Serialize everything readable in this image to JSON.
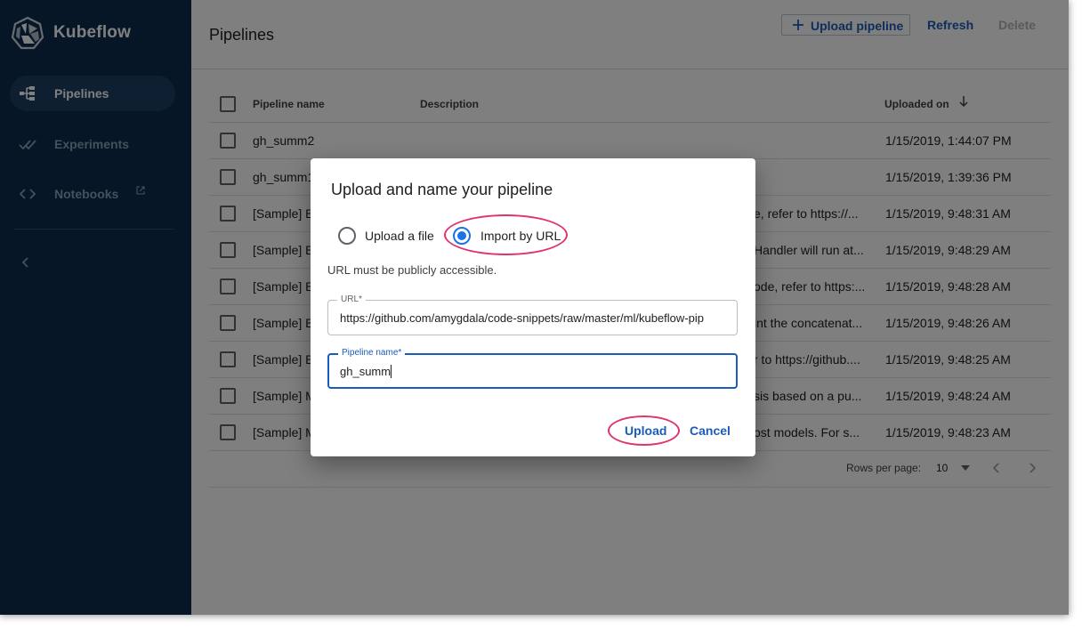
{
  "brand": {
    "name": "Kubeflow"
  },
  "sidebar": {
    "items": [
      {
        "label": "Pipelines",
        "icon": "pipelines-icon",
        "active": true
      },
      {
        "label": "Experiments",
        "icon": "experiments-icon",
        "active": false
      },
      {
        "label": "Notebooks",
        "icon": "notebooks-icon",
        "active": false,
        "external": true
      }
    ],
    "collapse_icon": "chevron-left-icon"
  },
  "page": {
    "title": "Pipelines"
  },
  "toolbar": {
    "upload_label": "Upload pipeline",
    "refresh_label": "Refresh",
    "delete_label": "Delete"
  },
  "table": {
    "columns": {
      "name": "Pipeline name",
      "description": "Description",
      "uploaded": "Uploaded on"
    },
    "sort": "descending",
    "rows": [
      {
        "name": "gh_summ2",
        "description": "",
        "uploaded": "1/15/2019, 1:44:07 PM"
      },
      {
        "name": "gh_summ1",
        "description": "",
        "uploaded": "1/15/2019, 1:39:36 PM"
      },
      {
        "name": "[Sample] B",
        "description": "e, refer to https://...",
        "uploaded": "1/15/2019, 9:48:31 AM"
      },
      {
        "name": "[Sample] B",
        "description": "Handler will run at...",
        "uploaded": "1/15/2019, 9:48:29 AM"
      },
      {
        "name": "[Sample] B",
        "description": "ode, refer to https:...",
        "uploaded": "1/15/2019, 9:48:28 AM"
      },
      {
        "name": "[Sample] B",
        "description": "int the concatenat...",
        "uploaded": "1/15/2019, 9:48:26 AM"
      },
      {
        "name": "[Sample] B",
        "description": "r to https://github....",
        "uploaded": "1/15/2019, 9:48:25 AM"
      },
      {
        "name": "[Sample] M",
        "description": "sis based on a pu...",
        "uploaded": "1/15/2019, 9:48:24 AM"
      },
      {
        "name": "[Sample] M",
        "description": "ost models. For s...",
        "uploaded": "1/15/2019, 9:48:23 AM"
      }
    ]
  },
  "pagination": {
    "rows_per_page_label": "Rows per page:",
    "rows_per_page": "10"
  },
  "dialog": {
    "title": "Upload and name your pipeline",
    "options": [
      {
        "label": "Upload a file",
        "selected": false
      },
      {
        "label": "Import by URL",
        "selected": true
      }
    ],
    "hint": "URL must be publicly accessible.",
    "url_field": {
      "label": "URL*",
      "value": "https://github.com/amygdala/code-snippets/raw/master/ml/kubeflow-pip"
    },
    "name_field": {
      "label": "Pipeline name*",
      "value": "gh_summ"
    },
    "upload_label": "Upload",
    "cancel_label": "Cancel"
  },
  "colors": {
    "sidebar": "#0c2d4e",
    "accent": "#1a5cb8",
    "radio": "#1a73e8",
    "highlight": "#e0336b"
  }
}
